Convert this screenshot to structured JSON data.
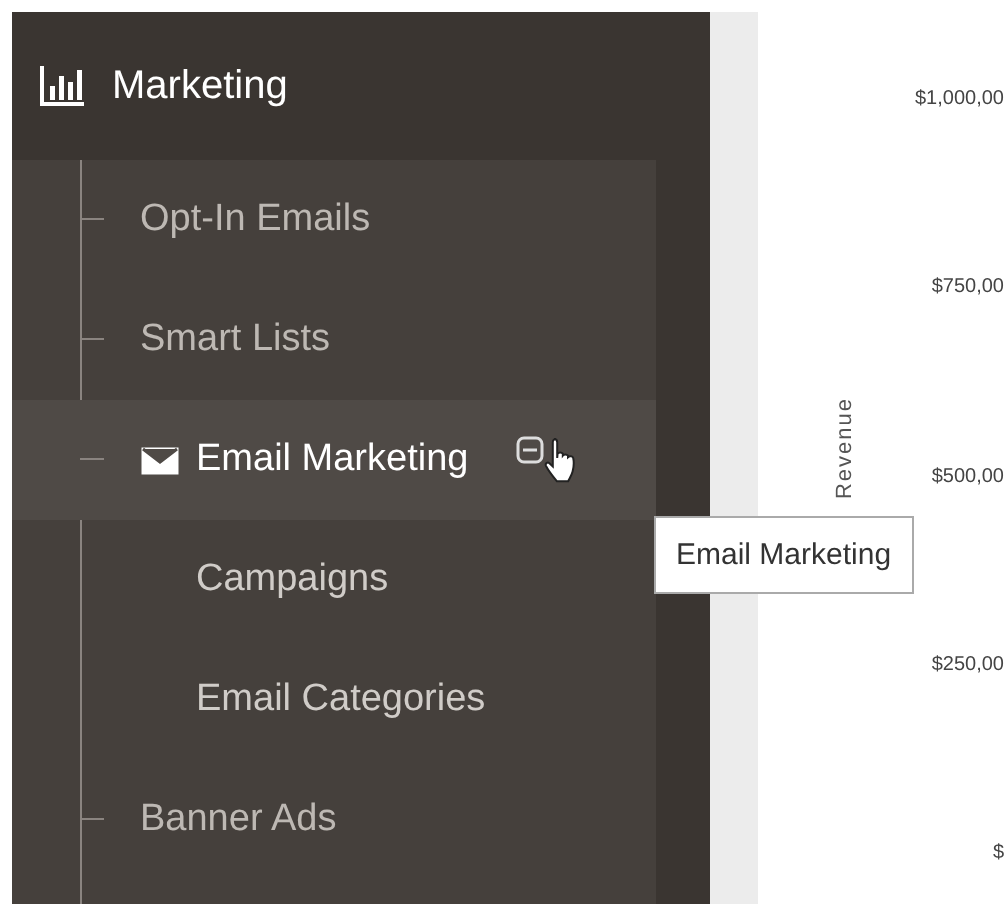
{
  "sidebar": {
    "title": "Marketing",
    "items": [
      {
        "label": "Opt-In Emails",
        "kind": "link",
        "selected": false
      },
      {
        "label": "Smart Lists",
        "kind": "link",
        "selected": false
      },
      {
        "label": "Email Marketing",
        "kind": "group",
        "selected": true,
        "expanded": true,
        "children": [
          {
            "label": "Campaigns"
          },
          {
            "label": "Email Categories"
          }
        ]
      },
      {
        "label": "Banner Ads",
        "kind": "link",
        "selected": false
      }
    ]
  },
  "chart_axis": {
    "ylabel": "Revenue",
    "ticks": [
      "$1,000,00",
      "$750,00",
      "$500,00",
      "$250,00",
      "$"
    ]
  },
  "tooltip": {
    "text": "Email Marketing"
  }
}
